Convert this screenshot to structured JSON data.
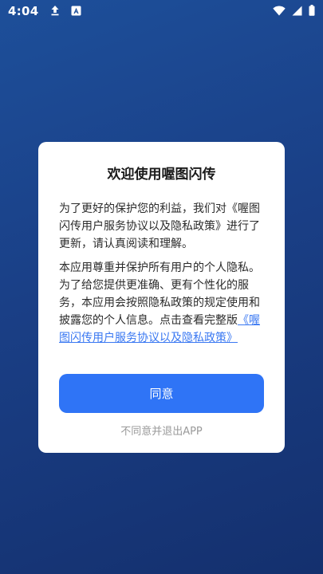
{
  "statusbar": {
    "time": "4:04",
    "icons": [
      "upload-icon",
      "app-notification-icon",
      "wifi-icon",
      "signal-icon",
      "battery-icon"
    ]
  },
  "dialog": {
    "title": "欢迎使用喔图闪传",
    "para1": "为了更好的保护您的利益，我们对《喔图闪传用户服务协议以及隐私政策》进行了更新，请认真阅读和理解。",
    "para2_text": "本应用尊重并保护所有用户的个人隐私。为了给您提供更准确、更有个性化的服务，本应用会按照隐私政策的规定使用和披露您的个人信息。点击查看完整版",
    "para2_link": "《喔图闪传用户服务协议以及隐私政策》",
    "agree_label": "同意",
    "decline_label": "不同意并退出APP"
  },
  "colors": {
    "background_top": "#1d4f9a",
    "background_bottom": "#14306e",
    "accent": "#2f74f6",
    "link": "#3a78f2"
  }
}
